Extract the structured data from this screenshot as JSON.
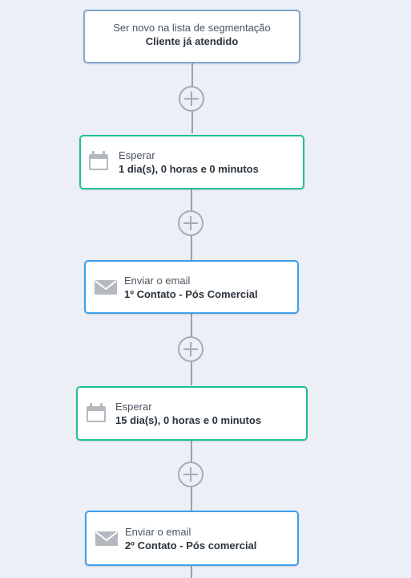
{
  "colors": {
    "background": "#eceff5",
    "connector": "#9aa1a9",
    "trigger_border": "#7fa8cf",
    "wait_border": "#22bf8f",
    "email_border": "#3d9ee8",
    "icon": "#b4b9bf"
  },
  "workflow": {
    "trigger": {
      "icon": "none",
      "line1": "Ser novo na lista de segmentação",
      "line2": "Cliente já atendido"
    },
    "add_icon": "plus-circle-icon",
    "steps": [
      {
        "type": "wait",
        "icon": "calendar-icon",
        "line1": "Esperar",
        "line2": "1 dia(s), 0 horas e 0 minutos"
      },
      {
        "type": "email",
        "icon": "envelope-icon",
        "line1": "Enviar o email",
        "line2": "1º Contato - Pós Comercial"
      },
      {
        "type": "wait",
        "icon": "calendar-icon",
        "line1": "Esperar",
        "line2": "15 dia(s), 0 horas e 0 minutos"
      },
      {
        "type": "email",
        "icon": "envelope-icon",
        "line1": "Enviar o email",
        "line2": "2º Contato - Pós comercial"
      }
    ]
  }
}
